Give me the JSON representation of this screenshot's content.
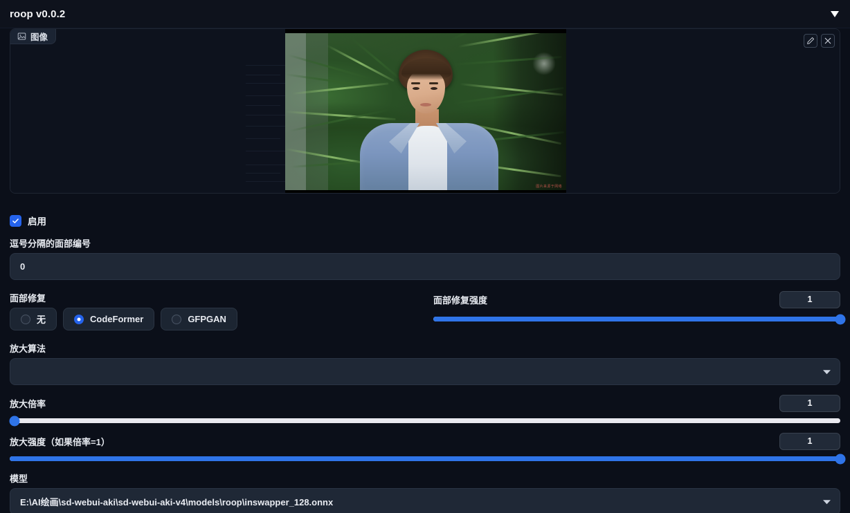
{
  "accordion": {
    "title": "roop v0.0.2",
    "toggle_icon": "caret-down-icon"
  },
  "image_panel": {
    "tab_label": "图像",
    "tab_icon": "image-icon",
    "actions": [
      {
        "name": "edit-image-button",
        "icon": "pencil-icon"
      },
      {
        "name": "clear-image-button",
        "icon": "close-icon"
      }
    ],
    "photo_watermark": "图片来源于网络"
  },
  "form": {
    "enable": {
      "label": "启用",
      "checked": true
    },
    "face_index": {
      "label": "逗号分隔的面部编号",
      "value": "0",
      "placeholder": ""
    },
    "face_restorer": {
      "label": "面部修复",
      "options": [
        "无",
        "CodeFormer",
        "GFPGAN"
      ],
      "selected": "CodeFormer"
    },
    "restorer_visibility": {
      "label": "面部修复强度",
      "value": "1",
      "min": 0,
      "max": 1,
      "percent": 100
    },
    "upscaler": {
      "label": "放大算法",
      "value": "",
      "arrow_icon": "chevron-down-icon"
    },
    "upscaler_scale": {
      "label": "放大倍率",
      "value": "1",
      "min": 1,
      "max": 8,
      "percent": 0
    },
    "upscaler_visibility": {
      "label": "放大强度（如果倍率=1）",
      "value": "1",
      "min": 0,
      "max": 1,
      "percent": 100
    },
    "model": {
      "label": "模型",
      "value": "E:\\AI绘画\\sd-webui-aki\\sd-webui-aki-v4\\models\\roop\\inswapper_128.onnx",
      "arrow_icon": "chevron-down-icon"
    }
  },
  "colors": {
    "accent": "#2563eb",
    "slider_blue": "#2f74e8",
    "slider_track": "#e9e9ef",
    "background": "#0b0f19",
    "panel": "#1f2836"
  }
}
